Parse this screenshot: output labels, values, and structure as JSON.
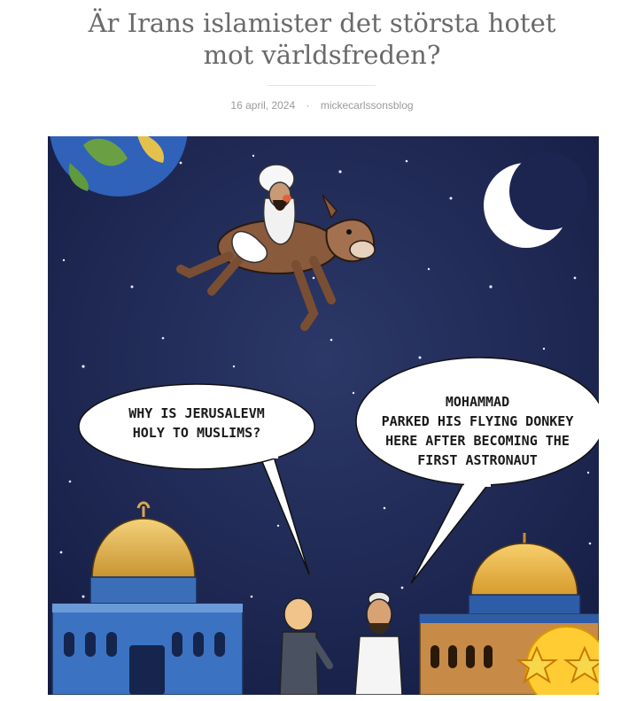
{
  "post": {
    "title_line1": "Är Irans islamister det största hotet",
    "title_line2": "mot världsfreden?",
    "date": "16 april, 2024",
    "separator": "·",
    "author": "mickecarlssonsblog"
  },
  "cartoon": {
    "bubble_left": [
      "WHY IS JERUSALEVM",
      "HOLY TO MUSLIMS?"
    ],
    "bubble_right": [
      "MOHAMMAD",
      "PARKED HIS FLYING DONKEY",
      "HERE AFTER BECOMING THE",
      "FIRST ASTRONAUT"
    ]
  },
  "colors": {
    "sky": "#1f2a57",
    "title_text": "#6a6a6a",
    "meta_text": "#9a9a9a"
  }
}
